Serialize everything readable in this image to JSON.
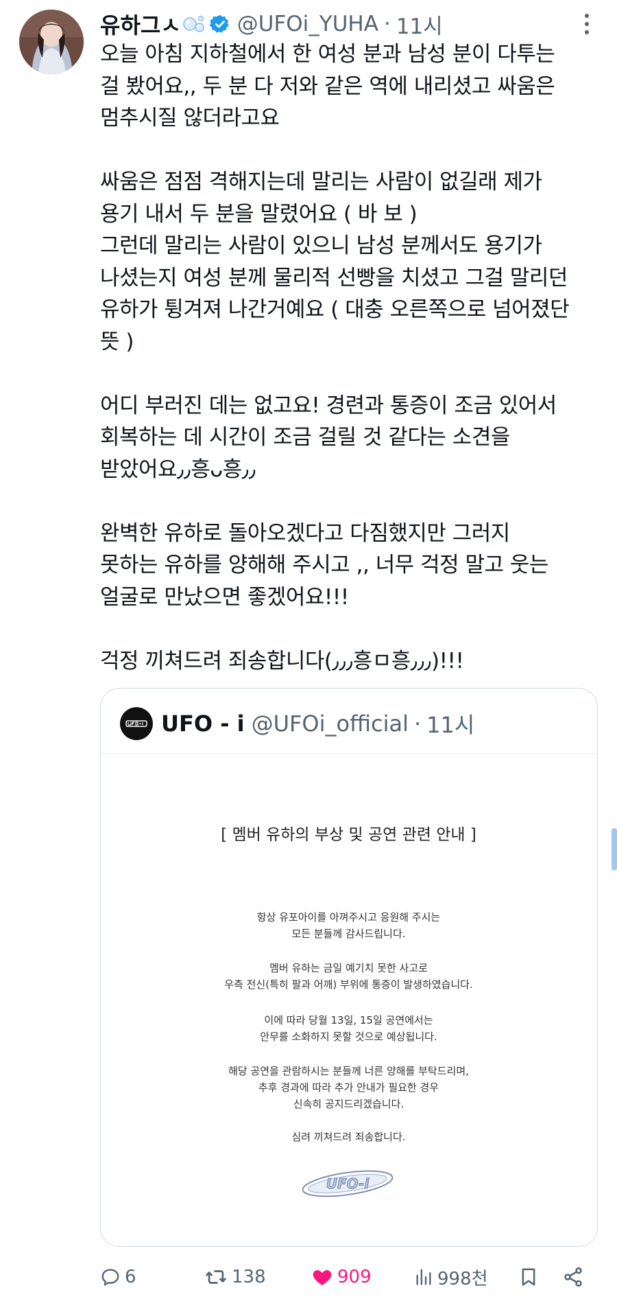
{
  "tweet": {
    "display_name": "유하그ㅅ",
    "name_emoji_icon": "bubbles-icon",
    "verified_icon": "verified-badge-icon",
    "handle": "@UFOi_YUHA",
    "separator": "·",
    "time": "11시",
    "more_icon": "more-vertical-icon",
    "body": "오늘 아침 지하철에서 한 여성 분과 남성 분이 다투는\n걸 봤어요,, 두 분 다 저와 같은 역에 내리셨고 싸움은\n멈추시질 않더라고요\n\n싸움은 점점 격해지는데 말리는 사람이 없길래 제가\n용기 내서 두 분을 말렸어요 ( 바 보 )\n그런데 말리는 사람이 있으니 남성 분께서도 용기가\n나셨는지 여성 분께 물리적 선빵을 치셨고 그걸 말리던\n유하가 튕겨져 나간거예요 ( 대충 오른쪽으로 넘어졌단\n뜻 )\n\n어디 부러진 데는 없고요! 경련과 통증이 조금 있어서\n회복하는 데 시간이 조금 걸릴 것 같다는 소견을\n받았어요٫٫흥ᴗ흥٫٫\n\n완벽한 유하로 돌아오겠다고 다짐했지만 그러지\n못하는 유하를 양해해 주시고 ,, 너무 걱정 말고 웃는\n얼굴로 만났으면 좋겠어요!!!\n\n걱정 끼쳐드려 죄송합니다(٫٫٫흥ㅁ흥٫٫٫)!!!"
  },
  "quote": {
    "logo_icon": "ufo-i-logo-icon",
    "name": "UFO - i",
    "handle": "@UFOi_official",
    "separator": "·",
    "time": "11시",
    "notice": {
      "title": "[ 멤버 유하의 부상 및 공연 관련 안내 ]",
      "para1": "항상 유포아이를 아껴주시고 응원해 주시는\n모든 분들께 감사드립니다.",
      "para2": "멤버 유하는 금일 예기치 못한 사고로\n우측 전신(특히 팔과 어깨) 부위에 통증이 발생하였습니다.",
      "para3": "이에 따라 당월 13일, 15일 공연에서는\n안무를 소화하지 못할 것으로 예상됩니다.",
      "para4": "해당 공연을 관람하시는 분들께 너른 양해를 부탁드리며,\n추후 경과에 따라 추가 안내가 필요한 경우\n신속히 공지드리겠습니다.",
      "para5": "심려 끼쳐드려 죄송합니다.",
      "brand_logo": "UFO-i"
    }
  },
  "actions": {
    "reply": {
      "icon": "reply-icon",
      "count": "6"
    },
    "retweet": {
      "icon": "retweet-icon",
      "count": "138"
    },
    "like": {
      "icon": "heart-filled-icon",
      "count": "909",
      "color": "#f91880"
    },
    "views": {
      "icon": "views-chart-icon",
      "count": "998천"
    },
    "bookmark": {
      "icon": "bookmark-icon"
    },
    "share": {
      "icon": "share-icon"
    }
  },
  "colors": {
    "text": "#0f1419",
    "secondary": "#536471",
    "verified": "#1d9bf0",
    "like": "#f91880",
    "border": "#cfd9de"
  }
}
